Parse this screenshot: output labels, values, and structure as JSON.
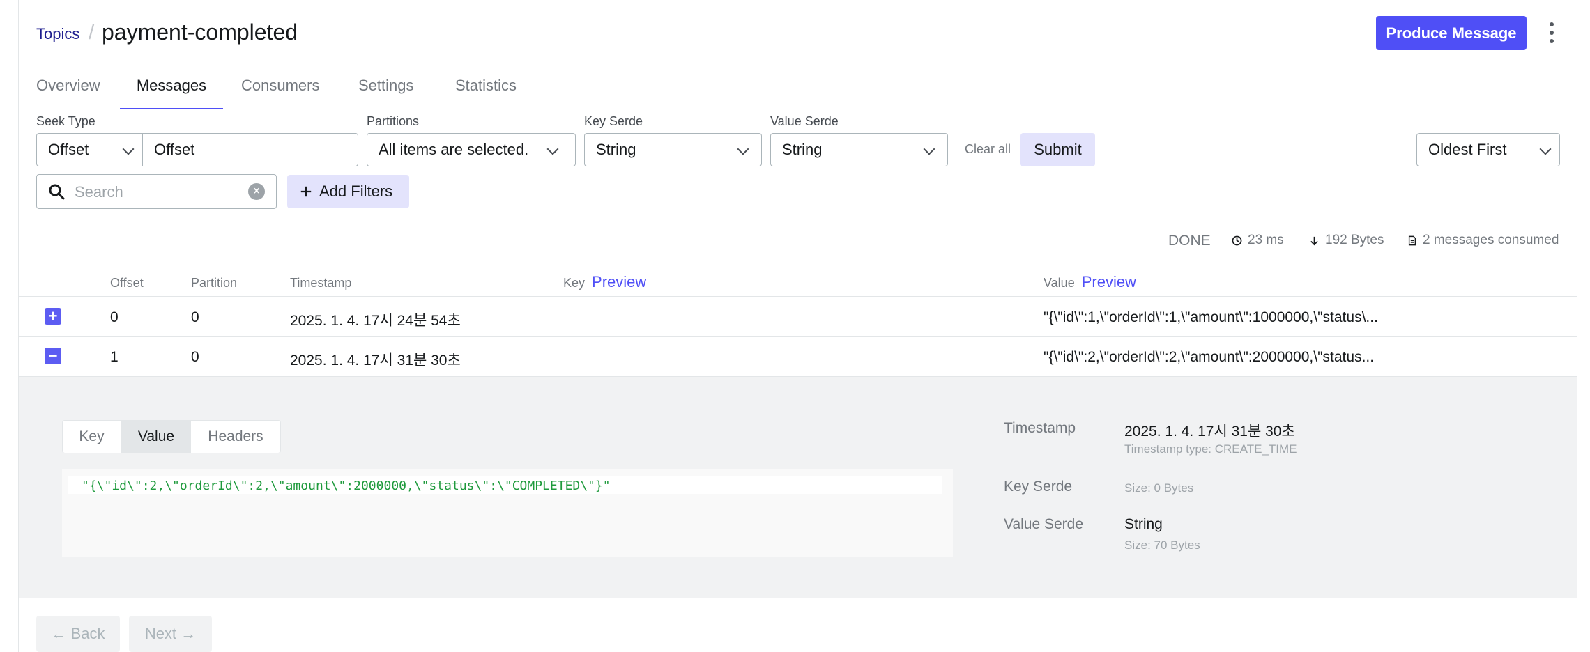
{
  "breadcrumb": {
    "parent": "Topics",
    "separator": "/",
    "current": "payment-completed"
  },
  "header": {
    "produce_label": "Produce Message"
  },
  "tabs": [
    {
      "label": "Overview"
    },
    {
      "label": "Messages"
    },
    {
      "label": "Consumers"
    },
    {
      "label": "Settings"
    },
    {
      "label": "Statistics"
    }
  ],
  "filters": {
    "seek_type_label": "Seek Type",
    "seek_type_value": "Offset",
    "seek_offset_value": "Offset",
    "partitions_label": "Partitions",
    "partitions_value": "All items are selected.",
    "key_serde_label": "Key Serde",
    "key_serde_value": "String",
    "value_serde_label": "Value Serde",
    "value_serde_value": "String",
    "clear_all": "Clear all",
    "submit": "Submit",
    "sort_value": "Oldest First",
    "search_placeholder": "Search",
    "add_filters": "Add Filters"
  },
  "stats": {
    "status": "DONE",
    "elapsed": "23 ms",
    "bytes": "192 Bytes",
    "consumed": "2 messages consumed"
  },
  "table": {
    "columns": {
      "offset": "Offset",
      "partition": "Partition",
      "timestamp": "Timestamp",
      "key": "Key",
      "key_preview": "Preview",
      "value": "Value",
      "value_preview": "Preview"
    },
    "rows": [
      {
        "toggle": "+",
        "offset": "0",
        "partition": "0",
        "timestamp": "2025. 1. 4. 17시 24분 54초",
        "value": "\"{\\\"id\\\":1,\\\"orderId\\\":1,\\\"amount\\\":1000000,\\\"status\\..."
      },
      {
        "toggle": "−",
        "offset": "1",
        "partition": "0",
        "timestamp": "2025. 1. 4. 17시 31분 30초",
        "value": "\"{\\\"id\\\":2,\\\"orderId\\\":2,\\\"amount\\\":2000000,\\\"status..."
      }
    ]
  },
  "detail": {
    "tabs": [
      "Key",
      "Value",
      "Headers"
    ],
    "code": "\"{\\\"id\\\":2,\\\"orderId\\\":2,\\\"amount\\\":2000000,\\\"status\\\":\\\"COMPLETED\\\"}\"",
    "timestamp_label": "Timestamp",
    "timestamp_value": "2025. 1. 4. 17시 31분 30초",
    "timestamp_type": "Timestamp type: CREATE_TIME",
    "key_serde_label": "Key Serde",
    "key_size": "Size: 0 Bytes",
    "value_serde_label": "Value Serde",
    "value_serde_value": "String",
    "value_size": "Size: 70 Bytes"
  },
  "pager": {
    "back": "← Back",
    "next": "Next →"
  },
  "colors": {
    "accent": "#4f4ff6",
    "code_green": "#1e9a3c"
  }
}
